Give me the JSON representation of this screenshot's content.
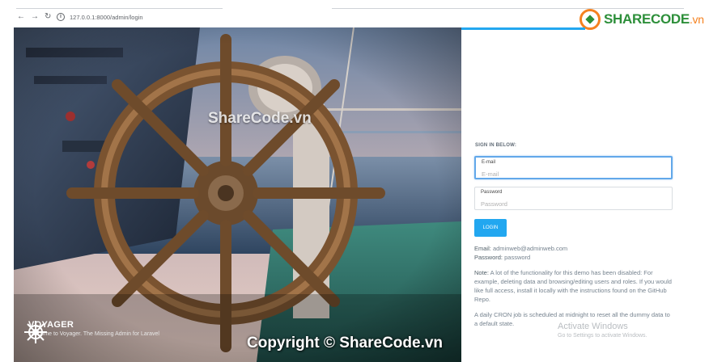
{
  "browser": {
    "url": "127.0.0.1:8000/admin/login",
    "back_icon": "arrow-left-icon",
    "forward_icon": "arrow-right-icon",
    "reload_icon": "reload-icon",
    "info_icon": "info-icon"
  },
  "watermark": {
    "logo_main": "SHARECODE",
    "logo_suffix": ".vn",
    "center_text": "ShareCode.vn",
    "copyright": "Copyright © ShareCode.vn"
  },
  "hero": {
    "brand_name": "VOYAGER",
    "brand_tagline": "Welcome to Voyager. The Missing Admin for Laravel",
    "brand_icon": "ship-wheel-icon"
  },
  "login": {
    "heading": "SIGN IN BELOW:",
    "email_label": "E-mail",
    "email_placeholder": "E-mail",
    "password_label": "Password",
    "password_placeholder": "Password",
    "button_label": "LOGIN"
  },
  "demo_info": {
    "email_key": "Email:",
    "email_value": "adminweb@adminweb.com",
    "password_key": "Password:",
    "password_value": "password",
    "note_key": "Note:",
    "note_text": "A lot of the functionality for this demo has been disabled: For example, deleting data and browsing/editing users and roles. If you would like full access, install it locally with the instructions found on the GitHub Repo.",
    "cron_text": "A daily CRON job is scheduled at midnight to reset all the dummy data to a default state."
  },
  "os_overlay": {
    "title": "Activate Windows",
    "subtitle": "Go to Settings to activate Windows."
  },
  "colors": {
    "accent": "#22a7f0",
    "focus_border": "#62a8ea",
    "logo_green": "#2d8f3a",
    "logo_orange": "#f58220"
  }
}
